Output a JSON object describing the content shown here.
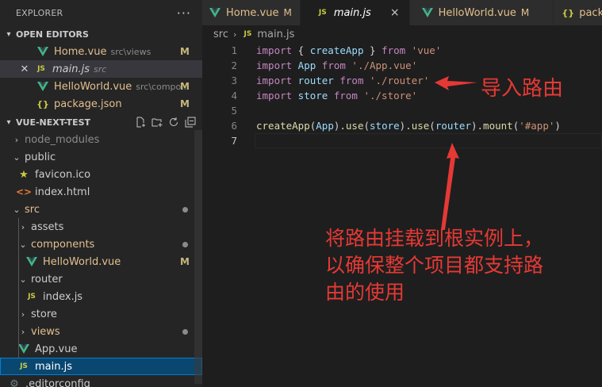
{
  "sidebar": {
    "title": "EXPLORER",
    "more_label": "···",
    "open_editors": {
      "title": "OPEN EDITORS",
      "items": [
        {
          "name": "Home.vue",
          "desc": "src\\views",
          "badge": "M"
        },
        {
          "name": "main.js",
          "desc": "src",
          "badge": ""
        },
        {
          "name": "HelloWorld.vue",
          "desc": "src\\compo...",
          "badge": "M"
        },
        {
          "name": "package.json",
          "desc": "",
          "badge": "M"
        }
      ]
    },
    "project": {
      "title": "VUE-NEXT-TEST",
      "tree": [
        {
          "name": "node_modules"
        },
        {
          "name": "public"
        },
        {
          "name": "favicon.ico"
        },
        {
          "name": "index.html"
        },
        {
          "name": "src"
        },
        {
          "name": "assets"
        },
        {
          "name": "components"
        },
        {
          "name": "HelloWorld.vue",
          "badge": "M"
        },
        {
          "name": "router"
        },
        {
          "name": "index.js"
        },
        {
          "name": "store"
        },
        {
          "name": "views"
        },
        {
          "name": "App.vue"
        },
        {
          "name": "main.js"
        },
        {
          "name": ".editorconfig"
        }
      ]
    }
  },
  "tabs": [
    {
      "label": "Home.vue",
      "mark": "M"
    },
    {
      "label": "main.js",
      "close": "×"
    },
    {
      "label": "HelloWorld.vue",
      "mark": "M"
    },
    {
      "label": "package.j"
    }
  ],
  "breadcrumb": {
    "folder": "src",
    "file": "main.js"
  },
  "editor": {
    "line_numbers": [
      "1",
      "2",
      "3",
      "4",
      "5",
      "6",
      "7"
    ],
    "code": {
      "l1": {
        "kw1": "import",
        "p1": " { ",
        "v1": "createApp",
        "p2": " } ",
        "kw2": "from",
        "s1": " 'vue'"
      },
      "l2": {
        "kw1": "import",
        "v1": " App ",
        "kw2": "from",
        "s1": " './App.vue'"
      },
      "l3": {
        "kw1": "import",
        "v1": " router ",
        "kw2": "from",
        "s1": " './router'"
      },
      "l4": {
        "kw1": "import",
        "v1": " store ",
        "kw2": "from",
        "s1": " './store'"
      },
      "l6": {
        "f1": "createApp",
        "p1": "(",
        "v1": "App",
        "p2": ").",
        "f2": "use",
        "p3": "(",
        "v2": "store",
        "p4": ").",
        "f3": "use",
        "p5": "(",
        "v3": "router",
        "p6": ").",
        "f4": "mount",
        "p7": "(",
        "s1": "'#app'",
        "p8": ")"
      }
    }
  },
  "annotations": {
    "import_note": "导入路由",
    "mount_note_lines": [
      "将路由挂载到根实例上，",
      "以确保整个项目都支持路",
      "由的使用"
    ]
  },
  "colors": {
    "annotation": "#e53935",
    "vue_icon": "#41b883",
    "js_icon": "#cbcb41",
    "modified": "#e2c08d",
    "selection": "#094771"
  }
}
